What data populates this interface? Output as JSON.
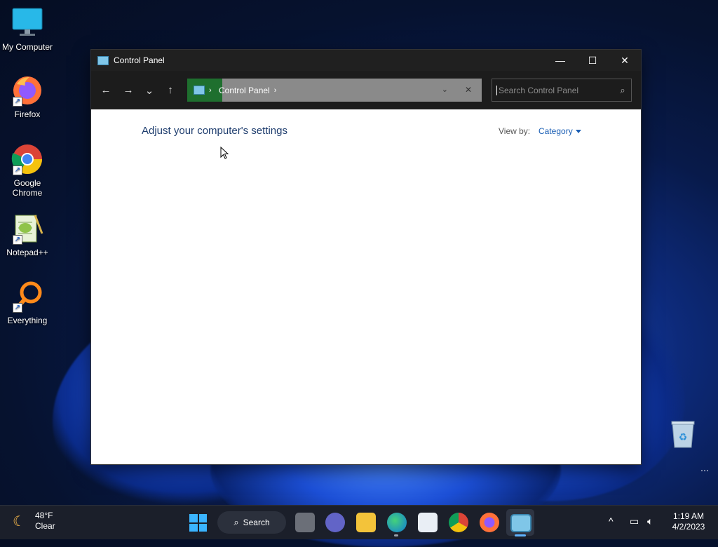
{
  "desktop": {
    "icons": [
      {
        "label": "My Computer"
      },
      {
        "label": "Firefox"
      },
      {
        "label": "Google Chrome"
      },
      {
        "label": "Notepad++"
      },
      {
        "label": "Everything"
      }
    ]
  },
  "window": {
    "title": "Control Panel",
    "controls": {
      "minimize": "—",
      "maximize": "☐",
      "close": "✕"
    },
    "nav": {
      "back": "←",
      "forward": "→",
      "recent": "⌄",
      "up": "↑"
    },
    "address": {
      "crumbs": [
        "Control Panel"
      ],
      "dropdown": "⌄",
      "clear": "✕"
    },
    "search": {
      "placeholder": "Search Control Panel"
    },
    "content": {
      "heading": "Adjust your computer's settings",
      "view_by_label": "View by:",
      "view_by_value": "Category"
    }
  },
  "taskbar": {
    "weather": {
      "temp": "48°F",
      "condition": "Clear"
    },
    "search_label": "Search",
    "clock": {
      "time": "1:19 AM",
      "date": "4/2/2023"
    },
    "tray_overflow": "^"
  },
  "colors": {
    "address_green": "#1e6f2e",
    "link_blue": "#1b5fb5",
    "heading_blue": "#1e3d6e"
  }
}
